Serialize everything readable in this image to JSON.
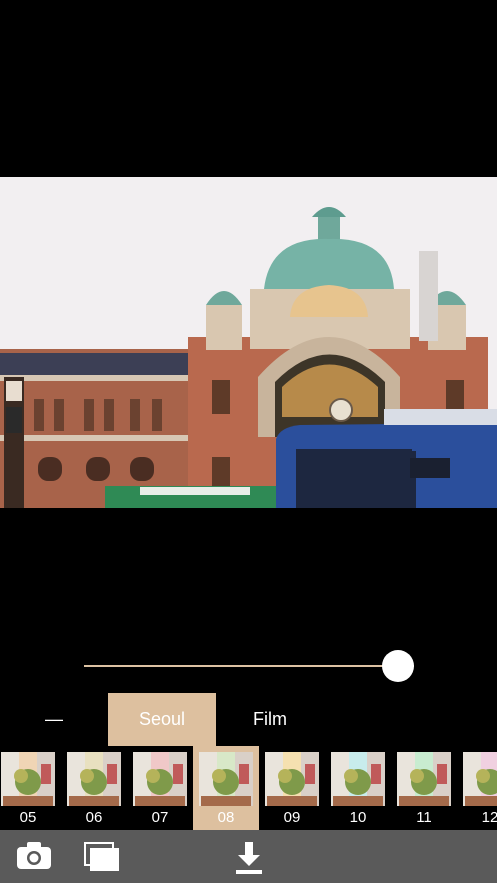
{
  "photo": {
    "subject": "Seoul station building"
  },
  "slider": {
    "value": 0.95
  },
  "categories": [
    {
      "label": "—",
      "active": false
    },
    {
      "label": "Seoul",
      "active": true
    },
    {
      "label": "Film",
      "active": false
    }
  ],
  "filters": [
    {
      "label": "05",
      "tint": "#f0d5b5",
      "active": false
    },
    {
      "label": "06",
      "tint": "#e8e0c0",
      "active": false
    },
    {
      "label": "07",
      "tint": "#f0c8c8",
      "active": false
    },
    {
      "label": "08",
      "tint": "#d8e8c8",
      "active": true
    },
    {
      "label": "09",
      "tint": "#f5e0b0",
      "active": false
    },
    {
      "label": "10",
      "tint": "#c8ecec",
      "active": false
    },
    {
      "label": "11",
      "tint": "#c8ecd0",
      "active": false
    },
    {
      "label": "12",
      "tint": "#f0d0e0",
      "active": false
    }
  ],
  "toolbar": {
    "camera": "camera-icon",
    "gallery": "gallery-icon",
    "download": "download-icon"
  },
  "colors": {
    "accent": "#ddc09f",
    "toolbar": "#5a5a5a"
  }
}
